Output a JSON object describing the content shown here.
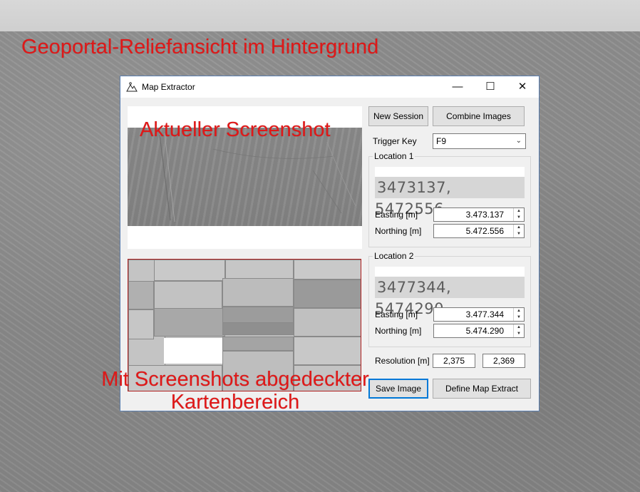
{
  "annotations": {
    "background": "Geoportal-Reliefansicht im Hintergrund",
    "screenshot": "Aktueller Screenshot",
    "coverage_line1": "Mit Screenshots abgedeckter",
    "coverage_line2": "Kartenbereich"
  },
  "window": {
    "title": "Map Extractor",
    "icon": "mountain-map-icon",
    "controls": {
      "minimize": "—",
      "maximize": "☐",
      "close": "✕"
    }
  },
  "toolbar": {
    "new_session": "New Session",
    "combine_images": "Combine Images"
  },
  "trigger": {
    "label": "Trigger Key",
    "value": "F9"
  },
  "location1": {
    "title": "Location 1",
    "ocr_text": "3473137, 5472556",
    "easting_label": "Easting [m]",
    "easting_value": "3.473.137",
    "northing_label": "Northing [m]",
    "northing_value": "5.472.556"
  },
  "location2": {
    "title": "Location 2",
    "ocr_text": "3477344, 5474290",
    "easting_label": "Easting [m]",
    "easting_value": "3.477.344",
    "northing_label": "Northing [m]",
    "northing_value": "5.474.290"
  },
  "resolution": {
    "label": "Resolution [m]",
    "x": "2,375",
    "y": "2,369"
  },
  "actions": {
    "save_image": "Save Image",
    "define_extract": "Define Map Extract"
  },
  "colors": {
    "annotation": "#e01818",
    "focus_border": "#0078d7",
    "coverage_border": "#b02020"
  }
}
